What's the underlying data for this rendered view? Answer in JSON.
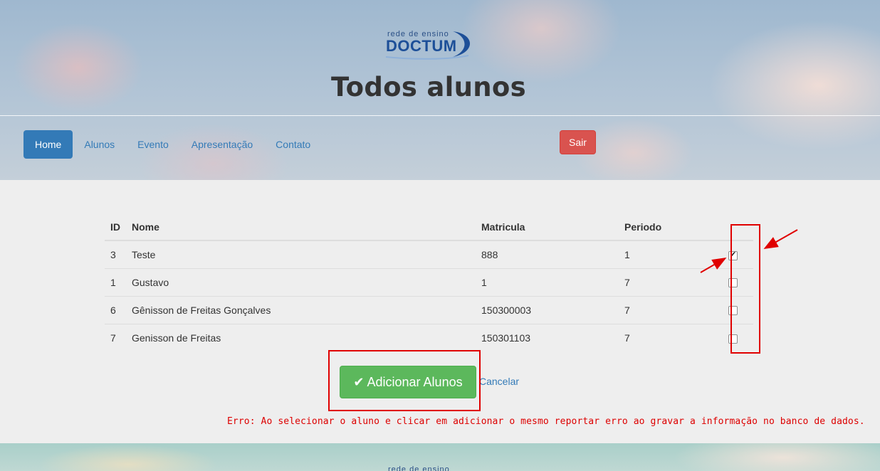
{
  "header": {
    "logo": {
      "small_text": "rede de ensino",
      "main_text": "DOCTUM"
    },
    "title": "Todos alunos",
    "nav": [
      {
        "label": "Home",
        "active": true
      },
      {
        "label": "Alunos",
        "active": false
      },
      {
        "label": "Evento",
        "active": false
      },
      {
        "label": "Apresentação",
        "active": false
      },
      {
        "label": "Contato",
        "active": false
      }
    ],
    "logout_label": "Sair"
  },
  "table": {
    "columns": [
      "ID",
      "Nome",
      "Matricula",
      "Periodo",
      ""
    ],
    "rows": [
      {
        "id": "3",
        "nome": "Teste",
        "matricula": "888",
        "periodo": "1",
        "checked": true
      },
      {
        "id": "1",
        "nome": "Gustavo",
        "matricula": "1",
        "periodo": "7",
        "checked": false
      },
      {
        "id": "6",
        "nome": "Gênisson de Freitas Gonçalves",
        "matricula": "150300003",
        "periodo": "7",
        "checked": false
      },
      {
        "id": "7",
        "nome": "Genisson de Freitas",
        "matricula": "150301103",
        "periodo": "7",
        "checked": false
      }
    ]
  },
  "actions": {
    "add_label": "Adicionar Alunos",
    "add_icon": "check-icon",
    "cancel_label": "Cancelar"
  },
  "error_message": "Erro: Ao selecionar o aluno e clicar em adicionar o mesmo reportar erro ao gravar a informação no banco de dados.",
  "colors": {
    "primary": "#337ab7",
    "danger": "#d9534f",
    "success": "#5cb85c",
    "annotation": "#e00000"
  }
}
